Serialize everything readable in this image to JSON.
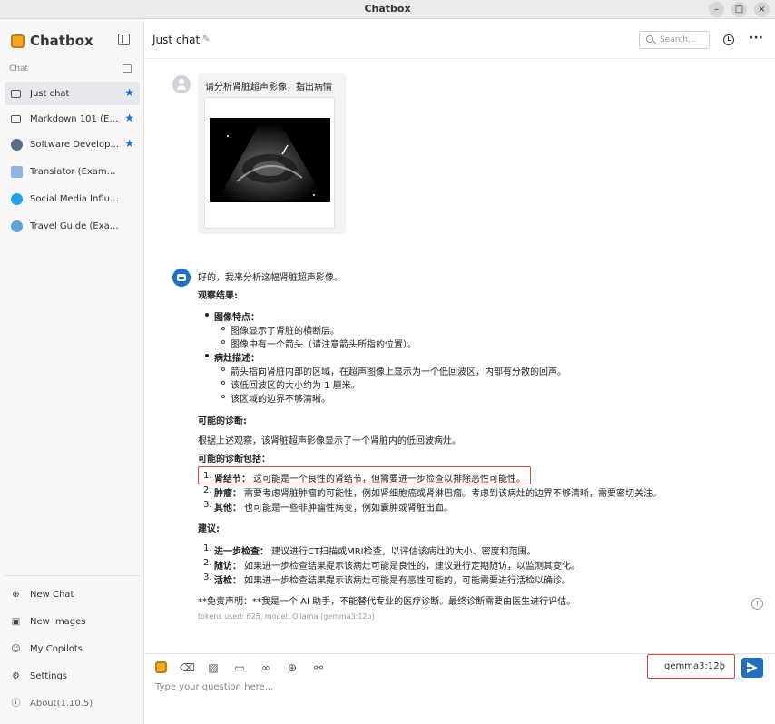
{
  "window": {
    "title": "Chatbox",
    "controls": [
      "–",
      "□",
      "×"
    ]
  },
  "sidebar": {
    "brand": "Chatbox",
    "section_label": "Chat",
    "chats": [
      {
        "label": "Just chat",
        "starred": true,
        "active": true,
        "icon": "chat-bubble-icon"
      },
      {
        "label": "Markdown 101 (Ex...",
        "starred": true,
        "active": false,
        "icon": "chat-bubble-icon"
      },
      {
        "label": "Software Develop...",
        "starred": true,
        "active": false,
        "icon": "developer-avatar-icon"
      },
      {
        "label": "Translator (Example)",
        "starred": false,
        "active": false,
        "icon": "translator-avatar-icon"
      },
      {
        "label": "Social Media Influencer ...",
        "starred": false,
        "active": false,
        "icon": "twitter-avatar-icon"
      },
      {
        "label": "Travel Guide (Example)",
        "starred": false,
        "active": false,
        "icon": "globe-avatar-icon"
      }
    ],
    "actions": [
      {
        "label": "New Chat",
        "icon": "plus-circle-icon",
        "glyph": "⊕"
      },
      {
        "label": "New Images",
        "icon": "image-icon",
        "glyph": "▣"
      },
      {
        "label": "My Copilots",
        "icon": "robot-icon",
        "glyph": "☺"
      },
      {
        "label": "Settings",
        "icon": "gear-icon",
        "glyph": "⚙"
      },
      {
        "label": "About(1.10.5)",
        "icon": "info-icon",
        "glyph": "ⓘ"
      }
    ]
  },
  "header": {
    "title": "Just chat",
    "search_placeholder": "Search..."
  },
  "user_message": {
    "text": "请分析肾脏超声影像，指出病情"
  },
  "assistant": {
    "intro": "好的，我来分析这幅肾脏超声影像。",
    "obs_title": "观察结果:",
    "b1_title": "图像特点：",
    "b1_items": [
      "图像显示了肾脏的横断层。",
      "图像中有一个箭头（请注意箭头所指的位置）。"
    ],
    "b2_title": "病灶描述：",
    "b2_items": [
      "箭头指向肾脏内部的区域，在超声图像上显示为一个低回波区，内部有分散的回声。",
      "该低回波区的大小约为 1 厘米。",
      "该区域的边界不够清晰。"
    ],
    "diag_title": "可能的诊断:",
    "diag_text": "根据上述观察，该肾脏超声影像显示了一个肾脏内的低回波病灶。",
    "diag_list_title": "可能的诊断包括：",
    "diag_list": [
      {
        "num": "1.",
        "title": "肾结节：",
        "text": "这可能是一个良性的肾结节，但需要进一步检查以排除恶性可能性。"
      },
      {
        "num": "2.",
        "title": "肿瘤：",
        "text": "需要考虑肾脏肿瘤的可能性，例如肾细胞癌或肾淋巴瘤。考虑到该病灶的边界不够清晰，需要密切关注。"
      },
      {
        "num": "3.",
        "title": "其他：",
        "text": "也可能是一些非肿瘤性病变，例如囊肿或肾脏出血。"
      }
    ],
    "sugg_title": "建议:",
    "sugg_list": [
      {
        "num": "1.",
        "title": "进一步检查：",
        "text": "建议进行CT扫描或MRI检查，以评估该病灶的大小、密度和范围。"
      },
      {
        "num": "2.",
        "title": "随访：",
        "text": "如果进一步检查结果提示该病灶可能是良性的，建议进行定期随访，以监测其变化。"
      },
      {
        "num": "3.",
        "title": "活检：",
        "text": "如果进一步检查结果提示该病灶可能是有恶性可能的，可能需要进行活检以确诊。"
      }
    ],
    "disclaimer": "**免责声明：**我是一个 AI 助手，不能替代专业的医疗诊断。最终诊断需要由医生进行评估。",
    "meta": "tokens used: 625, model: Ollama (gemma3:12b)"
  },
  "input": {
    "placeholder": "Type your question here...",
    "model": "gemma3:12b",
    "tools": [
      "logo-icon",
      "eraser-icon",
      "image-icon",
      "folder-icon",
      "link-icon",
      "globe-icon",
      "settings-sliders-icon"
    ]
  },
  "colors": {
    "accent": "#1f6fc5",
    "highlight": "#e0443a",
    "brand": "#f5a623"
  }
}
